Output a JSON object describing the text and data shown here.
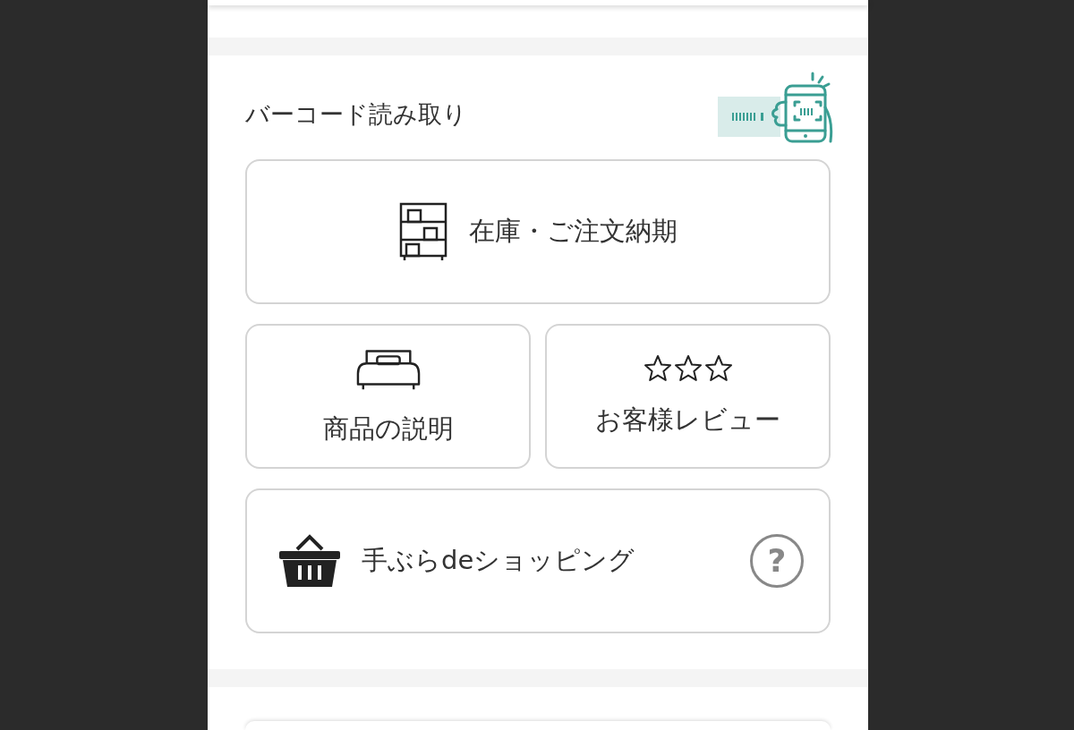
{
  "section": {
    "title": "バーコード読み取り"
  },
  "buttons": [
    {
      "kind": "stock",
      "label": "在庫・ご注文納期"
    },
    {
      "kind": "product",
      "label": "商品の説明"
    },
    {
      "kind": "review",
      "label": "お客様レビュー"
    },
    {
      "kind": "shopping",
      "label": "手ぶらdeショッピング",
      "help": "?"
    }
  ]
}
